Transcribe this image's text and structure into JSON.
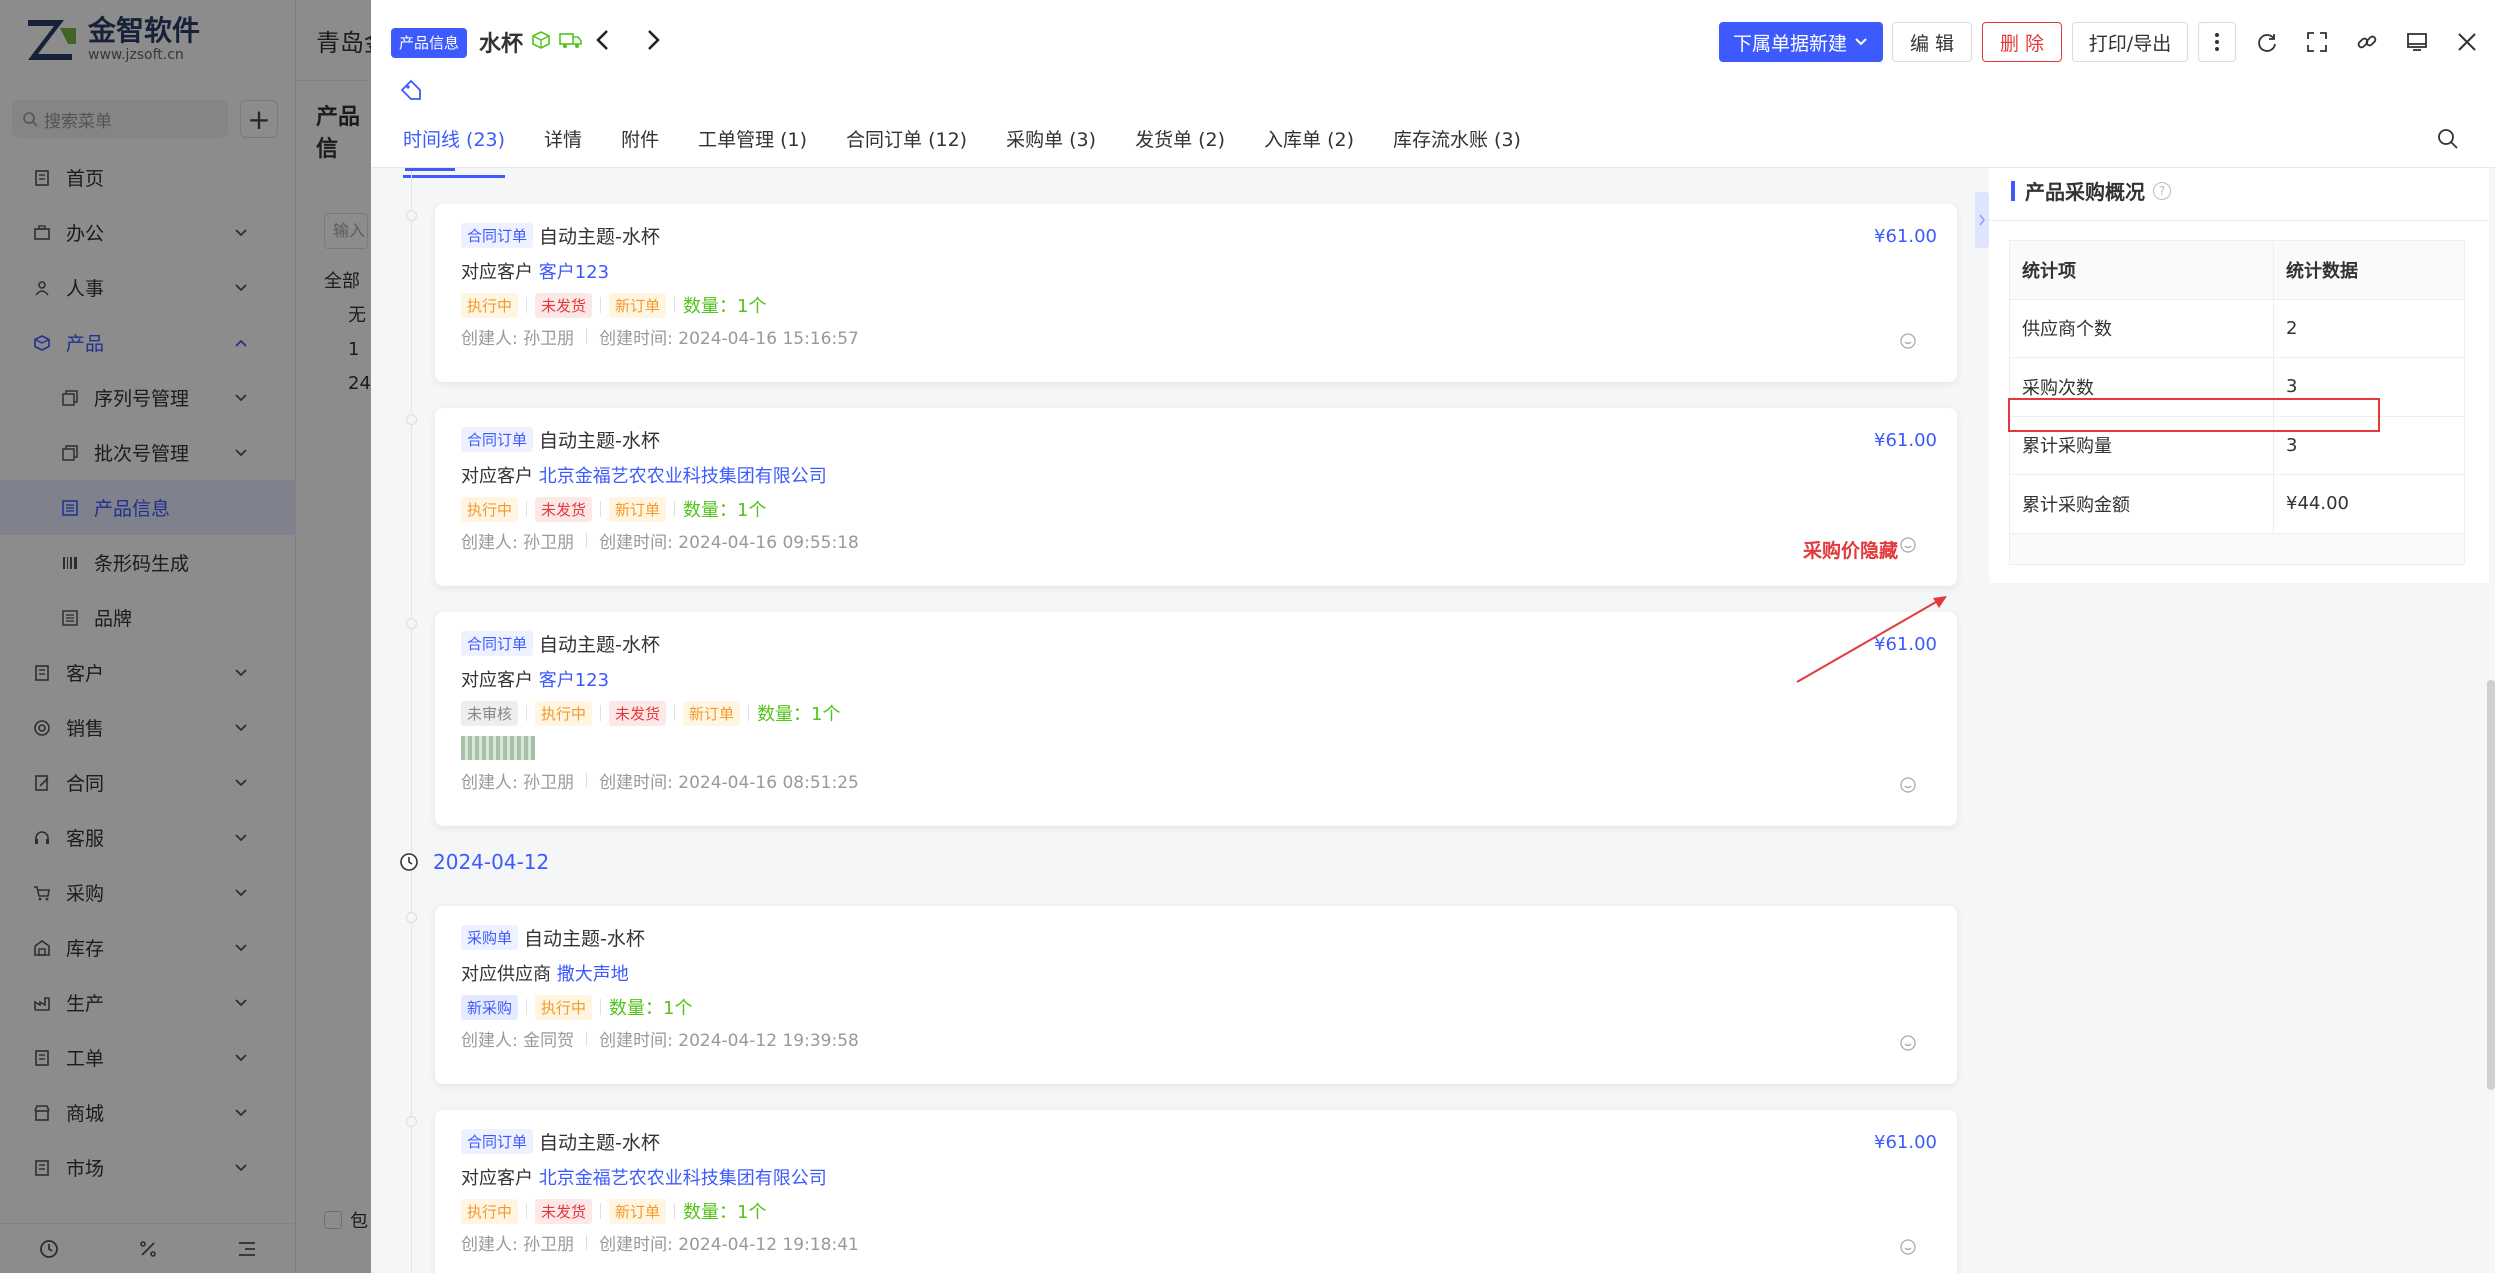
{
  "app": {
    "logo_title": "金智软件",
    "logo_sub": "www.jzsoft.cn",
    "menu_search_placeholder": "搜索菜单",
    "menu": [
      {
        "label": "首页",
        "icon": "doc-icon"
      },
      {
        "label": "办公",
        "icon": "briefcase-icon"
      },
      {
        "label": "人事",
        "icon": "people-icon"
      },
      {
        "label": "产品",
        "icon": "cube-icon",
        "expanded": true
      },
      {
        "label": "序列号管理",
        "icon": "copy-icon",
        "sub": true
      },
      {
        "label": "批次号管理",
        "icon": "copy-icon",
        "sub": true
      },
      {
        "label": "产品信息",
        "icon": "list-icon",
        "sub": true,
        "selected": true
      },
      {
        "label": "条形码生成",
        "icon": "barcode-icon",
        "sub": true
      },
      {
        "label": "品牌",
        "icon": "list-icon",
        "sub": true
      },
      {
        "label": "客户",
        "icon": "doc-icon"
      },
      {
        "label": "销售",
        "icon": "target-icon"
      },
      {
        "label": "合同",
        "icon": "contract-icon"
      },
      {
        "label": "客服",
        "icon": "headset-icon"
      },
      {
        "label": "采购",
        "icon": "cart-icon"
      },
      {
        "label": "库存",
        "icon": "warehouse-icon"
      },
      {
        "label": "生产",
        "icon": "factory-icon"
      },
      {
        "label": "工单",
        "icon": "doc-icon"
      },
      {
        "label": "商城",
        "icon": "shop-icon"
      },
      {
        "label": "市场",
        "icon": "doc-icon"
      }
    ]
  },
  "bg_page": {
    "header_title": "青岛金",
    "sub_title": "产品信",
    "input_placeholder": "输入",
    "tree": [
      "全部",
      "无",
      "1",
      "24"
    ],
    "checkbox_label": "包"
  },
  "drawer": {
    "badge": "产品信息",
    "name": "水杯",
    "buttons": {
      "new_sub": "下属单据新建",
      "edit": "编 辑",
      "delete": "删 除",
      "print": "打印/导出"
    },
    "tabs": [
      {
        "label": "时间线 (23)",
        "active": true
      },
      {
        "label": "详情"
      },
      {
        "label": "附件"
      },
      {
        "label": "工单管理 (1)"
      },
      {
        "label": "合同订单 (12)"
      },
      {
        "label": "采购单 (3)"
      },
      {
        "label": "发货单 (2)"
      },
      {
        "label": "入库单 (2)"
      },
      {
        "label": "库存流水账 (3)"
      }
    ]
  },
  "timeline": {
    "dates": [
      "2024-04-12"
    ],
    "cards": [
      {
        "type": "合同订单",
        "title": "自动主题-水杯",
        "price": "¥61.00",
        "cust_label": "对应客户",
        "cust": "客户123",
        "tags": [
          [
            "执行中",
            "orange"
          ],
          [
            "未发货",
            "red"
          ],
          [
            "新订单",
            "orange"
          ]
        ],
        "qty": "数量：1个",
        "creator": "创建人: 孙卫朋",
        "created": "创建时间: 2024-04-16 15:16:57"
      },
      {
        "type": "合同订单",
        "title": "自动主题-水杯",
        "price": "¥61.00",
        "cust_label": "对应客户",
        "cust": "北京金福艺农农业科技集团有限公司",
        "tags": [
          [
            "执行中",
            "orange"
          ],
          [
            "未发货",
            "red"
          ],
          [
            "新订单",
            "orange"
          ]
        ],
        "qty": "数量：1个",
        "creator": "创建人: 孙卫朋",
        "created": "创建时间: 2024-04-16 09:55:18"
      },
      {
        "type": "合同订单",
        "title": "自动主题-水杯",
        "price": "¥61.00",
        "cust_label": "对应客户",
        "cust": "客户123",
        "tags": [
          [
            "未审核",
            "gray"
          ],
          [
            "执行中",
            "orange"
          ],
          [
            "未发货",
            "red"
          ],
          [
            "新订单",
            "orange"
          ]
        ],
        "qty": "数量：1个",
        "creator": "创建人: 孙卫朋",
        "created": "创建时间: 2024-04-16 08:51:25"
      },
      {
        "type": "采购单",
        "title": "自动主题-水杯",
        "price": "",
        "cust_label": "对应供应商",
        "cust": "撒大声地",
        "tags": [
          [
            "新采购",
            "blue"
          ],
          [
            "执行中",
            "orange"
          ]
        ],
        "qty": "数量：1个",
        "creator": "创建人: 金同贺",
        "created": "创建时间: 2024-04-12 19:39:58"
      },
      {
        "type": "合同订单",
        "title": "自动主题-水杯",
        "price": "¥61.00",
        "cust_label": "对应客户",
        "cust": "北京金福艺农农业科技集团有限公司",
        "tags": [
          [
            "执行中",
            "orange"
          ],
          [
            "未发货",
            "red"
          ],
          [
            "新订单",
            "orange"
          ]
        ],
        "qty": "数量：1个",
        "creator": "创建人: 孙卫朋",
        "created": "创建时间: 2024-04-12 19:18:41"
      }
    ],
    "annotation": "采购价隐藏"
  },
  "overview": {
    "title": "产品采购概况",
    "headers": [
      "统计项",
      "统计数据"
    ],
    "rows": [
      [
        "供应商个数",
        "2"
      ],
      [
        "采购次数",
        "3"
      ],
      [
        "累计采购量",
        "3"
      ],
      [
        "累计采购金额",
        "¥44.00"
      ]
    ]
  },
  "colors": {
    "accent": "#3d5afe",
    "danger": "#e4393c",
    "success": "#52c41a",
    "warning": "#f29b2e"
  }
}
